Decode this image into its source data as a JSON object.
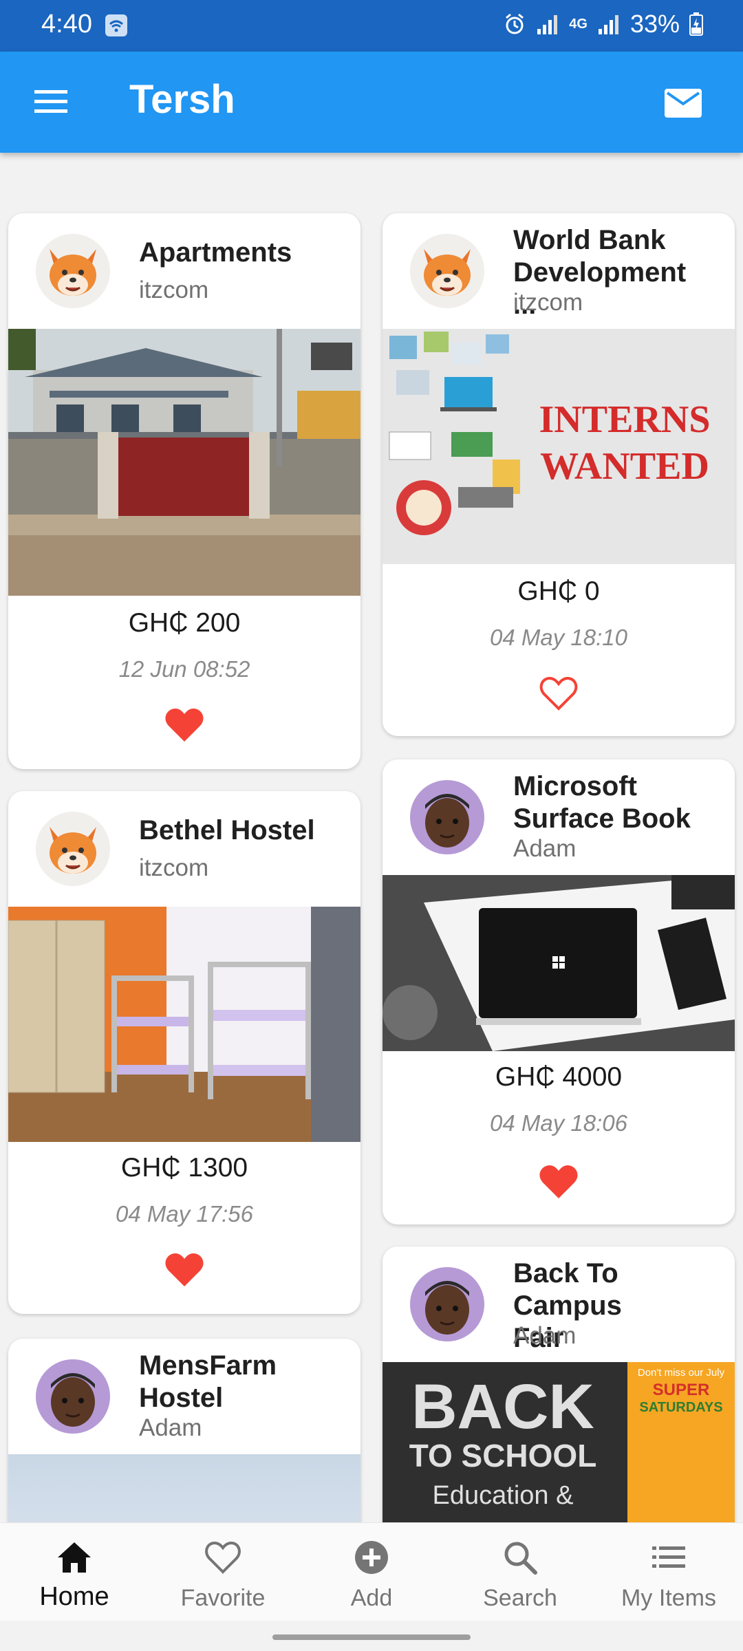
{
  "status": {
    "time": "4:40",
    "battery": "33%",
    "network": "4G"
  },
  "appbar": {
    "title": "Tersh",
    "menu_icon": "menu-icon",
    "mail_icon": "mail-icon"
  },
  "listings": [
    {
      "title": "Apartments",
      "owner": "itzcom",
      "price": "GH₵ 200",
      "date": "12 Jun 08:52",
      "favorited": true
    },
    {
      "title": "World Bank Development ...",
      "owner": "itzcom",
      "price": "GH₵ 0",
      "date": "04 May 18:10",
      "favorited": false,
      "image_text": [
        "INTERNS",
        "WANTED"
      ]
    },
    {
      "title": "Bethel Hostel",
      "owner": "itzcom",
      "price": "GH₵ 1300",
      "date": "04 May 17:56",
      "favorited": true
    },
    {
      "title": "Microsoft Surface Book",
      "owner": "Adam",
      "price": "GH₵ 4000",
      "date": "04 May 18:06",
      "favorited": true
    },
    {
      "title": "MensFarm Hostel",
      "owner": "Adam"
    },
    {
      "title": "Back To Campus Fair",
      "owner": "Adam",
      "image_text": [
        "BACK",
        "TO SCHOOL",
        "Education &",
        "Don't miss our July",
        "SUPER",
        "SATURDAYS"
      ]
    }
  ],
  "nav": [
    {
      "label": "Home",
      "icon": "home-icon",
      "active": true
    },
    {
      "label": "Favorite",
      "icon": "heart-outline-icon",
      "active": false
    },
    {
      "label": "Add",
      "icon": "add-circle-icon",
      "active": false
    },
    {
      "label": "Search",
      "icon": "search-icon",
      "active": false
    },
    {
      "label": "My Items",
      "icon": "list-icon",
      "active": false
    }
  ],
  "colors": {
    "status_bar": "#1a66c0",
    "app_bar": "#2196f3",
    "heart": "#f44336",
    "background": "#f2f2f2"
  }
}
